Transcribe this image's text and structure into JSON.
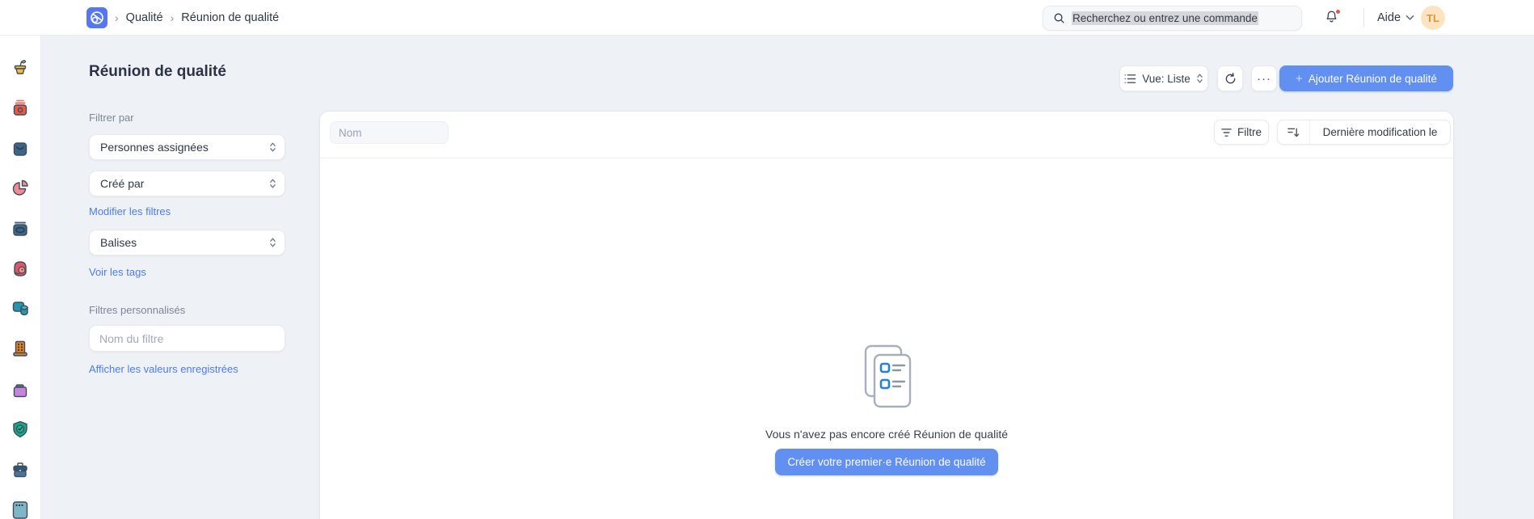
{
  "nav": {
    "breadcrumb": {
      "separator": "›",
      "items": [
        "Qualité",
        "Réunion de qualité"
      ]
    },
    "search": {
      "placeholder": "Recherchez ou entrez une commande"
    },
    "help_label": "Aide",
    "avatar_initials": "TL"
  },
  "rail": {
    "icons": [
      {
        "name": "seedling-pot-icon"
      },
      {
        "name": "camera-icon"
      },
      {
        "name": "shopping-bag-icon"
      },
      {
        "name": "pie-chart-icon"
      },
      {
        "name": "box-icon"
      },
      {
        "name": "support-icon"
      },
      {
        "name": "data-icon"
      },
      {
        "name": "building-icon"
      },
      {
        "name": "folder-icon"
      },
      {
        "name": "quality-shield-icon"
      },
      {
        "name": "briefcase-icon"
      },
      {
        "name": "calendar-icon"
      }
    ]
  },
  "page": {
    "title": "Réunion de qualité"
  },
  "toolbar": {
    "view_label": "Vue: Liste",
    "more_label": "···",
    "add_plus": "+",
    "add_label": "Ajouter Réunion de qualité"
  },
  "filters": {
    "section_label": "Filtrer par",
    "assigned_label": "Personnes assignées",
    "created_label": "Créé par",
    "edit_filters_link": "Modifier les filtres",
    "tags_label": "Balises",
    "view_tags_link": "Voir les tags",
    "custom_section_label": "Filtres personnalisés",
    "filter_name_placeholder": "Nom du filtre",
    "show_saved_link": "Afficher les valeurs enregistrées"
  },
  "list": {
    "name_placeholder": "Nom",
    "filter_button_label": "Filtre",
    "sort_button_label": "Dernière modification le",
    "empty_message": "Vous n'avez pas encore créé Réunion de qualité",
    "empty_cta_label": "Créer votre premier·e Réunion de qualité"
  },
  "colors": {
    "accent_blue": "#6290f1",
    "link_blue": "#4c7cf1",
    "logo_blue": "#5578ee",
    "avatar_bg": "#fce4c2",
    "avatar_text": "#de9638",
    "search_selection_bg": "#d5d7da",
    "page_bg": "#eef1f5"
  }
}
